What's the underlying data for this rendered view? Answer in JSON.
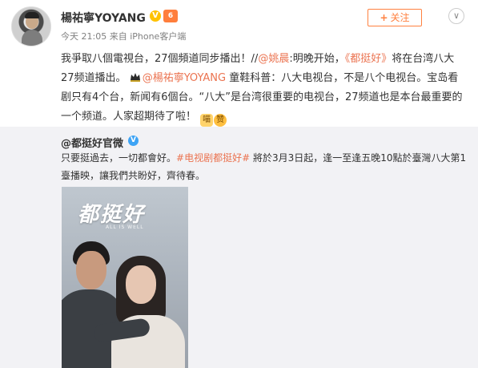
{
  "post": {
    "username": "楊祐寧YOYANG",
    "verified_mark": "V",
    "level_mark": "6",
    "meta": "今天 21:05 来自 iPhone客户端",
    "follow_plus": "+",
    "follow_label": "关注",
    "more_glyph": "∨",
    "text": {
      "part1": "我爭取八個電視台，27個頻道同步播出！//",
      "mention1": "@姚晨",
      "part2": ":明晚开始，",
      "show_title": "《都挺好》",
      "part3": "将在台湾八大27频道播出。",
      "mention2": "@楊祐寧YOYANG",
      "part4": "  童鞋科普：八大电视台，不是八个电视台。宝岛看剧只有4个台，新闻有6個台。“八大”是台湾很重要的电视台，27频道也是本台最重要的一个频道。人家超期待了啦！",
      "emoji_cat": "喵",
      "emoji_clap": "赞"
    }
  },
  "repost": {
    "author": "@都挺好官微",
    "verified_mark": "V",
    "text_part1": "只要挺過去，一切都會好。",
    "hashtag": "#电视剧都挺好#",
    "text_part2": " 將於3月3日起，逢一至逢五晚10點於臺灣八大第1臺播映，讓我們共盼好，齊待春。",
    "poster": {
      "title": "都挺好",
      "subtitle": "ALL IS WELL"
    }
  },
  "colors": {
    "link": "#eb7350",
    "follow": "#ff8140",
    "repost_bg": "#f2f2f5",
    "verified_gold": "#ffc200",
    "verified_blue": "#3ea4f5"
  }
}
